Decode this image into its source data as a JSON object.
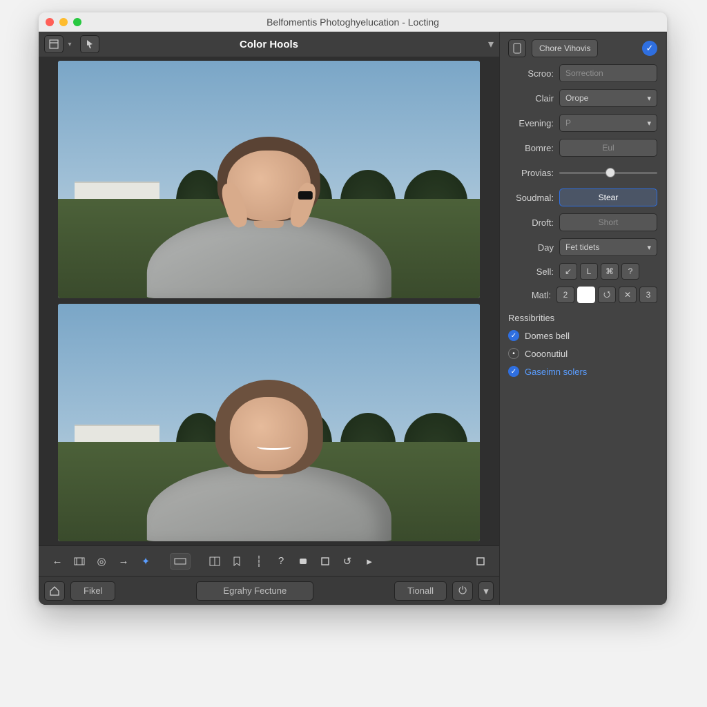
{
  "window": {
    "title": "Belfomentis Photoghyelucation - Locting"
  },
  "editor": {
    "header_title": "Color Hools"
  },
  "toolbar_bottom": {
    "btn1": "Fikel",
    "btn2": "Egrahy Fectune",
    "btn3": "Tionall"
  },
  "side": {
    "chip_label": "Chore Vihovis",
    "fields": {
      "scroo": {
        "label": "Scroo:",
        "value": "Sorrection"
      },
      "clair": {
        "label": "Clair",
        "value": "Orope"
      },
      "evening": {
        "label": "Evening:",
        "value": "P"
      },
      "bomre": {
        "label": "Bomre:",
        "value": "Eul"
      },
      "provias": {
        "label": "Provias:"
      },
      "soudmal": {
        "label": "Soudmal:",
        "value": "Stear"
      },
      "droft": {
        "label": "Droft:",
        "value": "Short"
      },
      "day": {
        "label": "Day",
        "value": "Fet tidets"
      },
      "sell": {
        "label": "Sell:"
      },
      "matl": {
        "label": "Matl:",
        "v1": "2",
        "v2": "3"
      }
    },
    "responsibilities": {
      "heading": "Ressibrities",
      "opt1": "Domes bell",
      "opt2": "Cooonutiul",
      "opt3": "Gaseimn solers"
    }
  }
}
